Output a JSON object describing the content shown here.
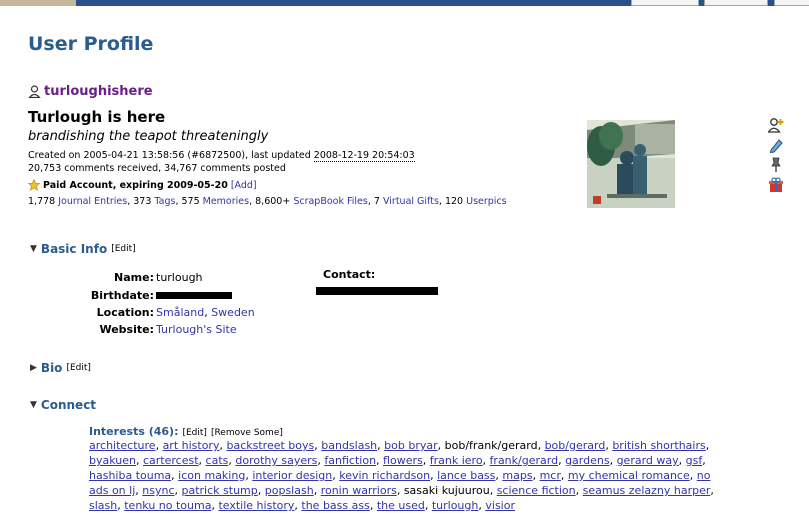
{
  "page": {
    "title": "User Profile"
  },
  "user": {
    "username": "turloughishere",
    "journal_title": "Turlough is here",
    "journal_subtitle": "brandishing the teapot threateningly",
    "created_prefix": "Created on 2005-04-21 13:58:56 (#6872500), last updated ",
    "last_updated": "2008-12-19 20:54:03",
    "comments": "20,753 comments received, 34,767 comments posted",
    "paid_account": "Paid Account, expiring 2009-05-20",
    "add_label": "[Add]"
  },
  "stats": [
    {
      "num": "1,778",
      "label": "Journal Entries"
    },
    {
      "num": "373",
      "label": "Tags"
    },
    {
      "num": "575",
      "label": "Memories"
    },
    {
      "num": "8,600+",
      "label": "ScrapBook Files"
    },
    {
      "num": "7",
      "label": "Virtual Gifts"
    },
    {
      "num": "120",
      "label": "Userpics"
    }
  ],
  "basic_info": {
    "heading": "Basic Info",
    "edit": "[Edit]",
    "name_label": "Name:",
    "name_value": "turlough",
    "birthdate_label": "Birthdate:",
    "location_label": "Location:",
    "location_region": "Småland",
    "location_country": "Sweden",
    "website_label": "Website:",
    "website_value": "Turlough's Site",
    "contact_label": "Contact:"
  },
  "bio": {
    "heading": "Bio",
    "edit": "[Edit]"
  },
  "connect": {
    "heading": "Connect",
    "interests_label": "Interests (46):",
    "edit": "[Edit]",
    "remove": "[Remove Some]",
    "interests": [
      {
        "t": "architecture",
        "link": true
      },
      {
        "t": "art history",
        "link": true
      },
      {
        "t": "backstreet boys",
        "link": true
      },
      {
        "t": "bandslash",
        "link": true
      },
      {
        "t": "bob bryar",
        "link": true
      },
      {
        "t": "bob/frank/gerard",
        "link": false
      },
      {
        "t": "bob/gerard",
        "link": true
      },
      {
        "t": "british shorthairs",
        "link": true
      },
      {
        "t": "byakuen",
        "link": true
      },
      {
        "t": "cartercest",
        "link": true
      },
      {
        "t": "cats",
        "link": true
      },
      {
        "t": "dorothy sayers",
        "link": true
      },
      {
        "t": "fanfiction",
        "link": true
      },
      {
        "t": "flowers",
        "link": true
      },
      {
        "t": "frank iero",
        "link": true
      },
      {
        "t": "frank/gerard",
        "link": true
      },
      {
        "t": "gardens",
        "link": true
      },
      {
        "t": "gerard way",
        "link": true
      },
      {
        "t": "gsf",
        "link": true
      },
      {
        "t": "hashiba touma",
        "link": true
      },
      {
        "t": "icon making",
        "link": true
      },
      {
        "t": "interior design",
        "link": true
      },
      {
        "t": "kevin richardson",
        "link": true
      },
      {
        "t": "lance bass",
        "link": true
      },
      {
        "t": "maps",
        "link": true
      },
      {
        "t": "mcr",
        "link": true
      },
      {
        "t": "my chemical romance",
        "link": true
      },
      {
        "t": "no ads on lj",
        "link": true
      },
      {
        "t": "nsync",
        "link": true
      },
      {
        "t": "patrick stump",
        "link": true
      },
      {
        "t": "popslash",
        "link": true
      },
      {
        "t": "ronin warriors",
        "link": true
      },
      {
        "t": "sasaki kujuurou",
        "link": false
      },
      {
        "t": "science fiction",
        "link": true
      },
      {
        "t": "seamus zelazny harper",
        "link": true
      },
      {
        "t": "slash",
        "link": true
      },
      {
        "t": "tenku no touma",
        "link": true
      },
      {
        "t": "textile history",
        "link": true
      },
      {
        "t": "the bass ass",
        "link": true
      },
      {
        "t": "the used",
        "link": true
      },
      {
        "t": "turlough",
        "link": true
      },
      {
        "t": "visior",
        "link": true
      }
    ]
  }
}
